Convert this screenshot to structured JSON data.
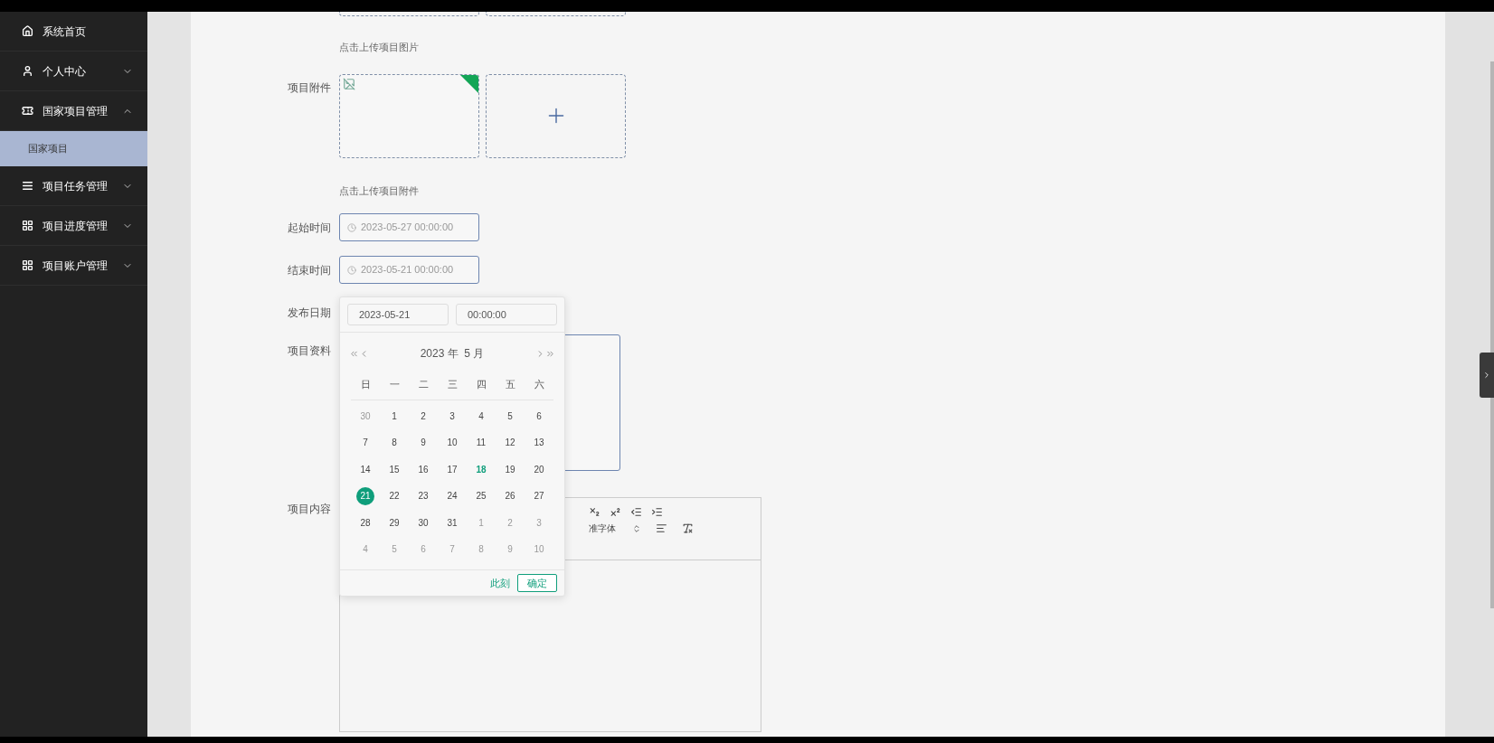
{
  "sidebar": {
    "items": [
      {
        "label": "系统首页"
      },
      {
        "label": "个人中心",
        "expanded": false
      },
      {
        "label": "国家项目管理",
        "expanded": true,
        "children": [
          {
            "label": "国家项目",
            "selected": true
          }
        ]
      },
      {
        "label": "项目任务管理",
        "expanded": false
      },
      {
        "label": "项目进度管理",
        "expanded": false
      },
      {
        "label": "项目账户管理",
        "expanded": false
      }
    ]
  },
  "form": {
    "image_upload": {
      "hint": "点击上传项目图片"
    },
    "attachment": {
      "label": "项目附件",
      "boxes": [
        {
          "kind": "file"
        },
        {
          "kind": "add"
        }
      ],
      "hint": "点击上传项目附件"
    },
    "start_time": {
      "label": "起始时间",
      "value": "2023-05-27 00:00:00"
    },
    "end_time": {
      "label": "结束时间",
      "value": "2023-05-21 00:00:00"
    },
    "publish_date": {
      "label": "发布日期"
    },
    "material": {
      "label": "项目资料"
    },
    "content": {
      "label": "项目内容",
      "font_select": "准字体"
    }
  },
  "date_picker": {
    "date_value": "2023-05-21",
    "time_value": "00:00:00",
    "title": "2023 年  5 月",
    "weekdays": [
      "日",
      "一",
      "二",
      "三",
      "四",
      "五",
      "六"
    ],
    "weeks": [
      [
        {
          "d": "30",
          "kind": "other",
          "selected": false
        },
        {
          "d": "1",
          "kind": "current",
          "selected": false
        },
        {
          "d": "2",
          "kind": "current",
          "selected": false
        },
        {
          "d": "3",
          "kind": "current",
          "selected": false
        },
        {
          "d": "4",
          "kind": "current",
          "selected": false
        },
        {
          "d": "5",
          "kind": "current",
          "selected": false
        },
        {
          "d": "6",
          "kind": "current",
          "selected": false
        }
      ],
      [
        {
          "d": "7",
          "kind": "current",
          "selected": false
        },
        {
          "d": "8",
          "kind": "current",
          "selected": false
        },
        {
          "d": "9",
          "kind": "current",
          "selected": false
        },
        {
          "d": "10",
          "kind": "current",
          "selected": false
        },
        {
          "d": "11",
          "kind": "current",
          "selected": false
        },
        {
          "d": "12",
          "kind": "current",
          "selected": false
        },
        {
          "d": "13",
          "kind": "current",
          "selected": false
        }
      ],
      [
        {
          "d": "14",
          "kind": "current",
          "selected": false
        },
        {
          "d": "15",
          "kind": "current",
          "selected": false
        },
        {
          "d": "16",
          "kind": "current",
          "selected": false
        },
        {
          "d": "17",
          "kind": "current",
          "selected": false
        },
        {
          "d": "18",
          "kind": "today",
          "selected": false
        },
        {
          "d": "19",
          "kind": "current",
          "selected": false
        },
        {
          "d": "20",
          "kind": "current",
          "selected": false
        }
      ],
      [
        {
          "d": "21",
          "kind": "current",
          "selected": true
        },
        {
          "d": "22",
          "kind": "current",
          "selected": false
        },
        {
          "d": "23",
          "kind": "current",
          "selected": false
        },
        {
          "d": "24",
          "kind": "current",
          "selected": false
        },
        {
          "d": "25",
          "kind": "current",
          "selected": false
        },
        {
          "d": "26",
          "kind": "current",
          "selected": false
        },
        {
          "d": "27",
          "kind": "current",
          "selected": false
        }
      ],
      [
        {
          "d": "28",
          "kind": "current",
          "selected": false
        },
        {
          "d": "29",
          "kind": "current",
          "selected": false
        },
        {
          "d": "30",
          "kind": "current",
          "selected": false
        },
        {
          "d": "31",
          "kind": "current",
          "selected": false
        },
        {
          "d": "1",
          "kind": "other",
          "selected": false
        },
        {
          "d": "2",
          "kind": "other",
          "selected": false
        },
        {
          "d": "3",
          "kind": "other",
          "selected": false
        }
      ],
      [
        {
          "d": "4",
          "kind": "other",
          "selected": false
        },
        {
          "d": "5",
          "kind": "other",
          "selected": false
        },
        {
          "d": "6",
          "kind": "other",
          "selected": false
        },
        {
          "d": "7",
          "kind": "other",
          "selected": false
        },
        {
          "d": "8",
          "kind": "other",
          "selected": false
        },
        {
          "d": "9",
          "kind": "other",
          "selected": false
        },
        {
          "d": "10",
          "kind": "other",
          "selected": false
        }
      ]
    ],
    "now_link": "此刻",
    "confirm": "确定"
  }
}
